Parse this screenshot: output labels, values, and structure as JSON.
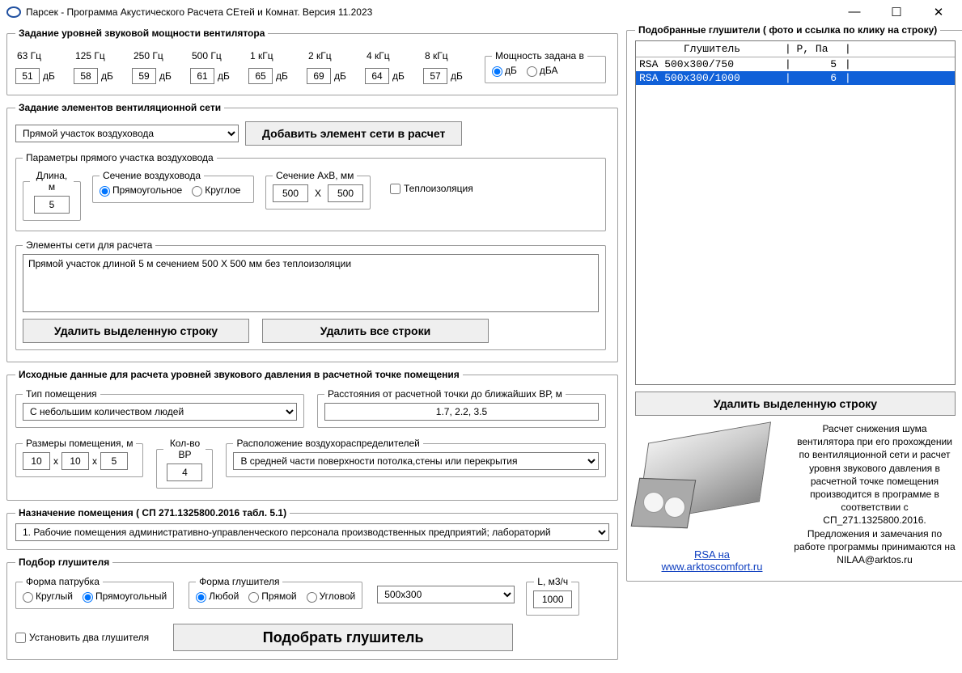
{
  "window": {
    "title": "Парсек - Программа Акустического Расчета СЕтей и Комнат.    Версия 11.2023"
  },
  "fan": {
    "legend": "Задание уровней звуковой мощности вентилятора",
    "freqs": [
      {
        "label": "63 Гц",
        "val": "51"
      },
      {
        "label": "125 Гц",
        "val": "58"
      },
      {
        "label": "250 Гц",
        "val": "59"
      },
      {
        "label": "500 Гц",
        "val": "61"
      },
      {
        "label": "1 кГц",
        "val": "65"
      },
      {
        "label": "2 кГц",
        "val": "69"
      },
      {
        "label": "4 кГц",
        "val": "64"
      },
      {
        "label": "8 кГц",
        "val": "57"
      }
    ],
    "db_suffix": "дБ",
    "power_legend": "Мощность задана в",
    "opt_db": "дБ",
    "opt_dba": "дБА"
  },
  "net": {
    "legend": "Задание элементов вентиляционной сети",
    "element_select": "Прямой участок воздуховода",
    "add_btn": "Добавить элемент сети в расчет",
    "params_legend": "Параметры прямого участка воздуховода",
    "len_legend": "Длина, м",
    "len": "5",
    "sect_legend": "Сечение воздуховода",
    "sect_rect": "Прямоугольное",
    "sect_round": "Круглое",
    "axb_legend": "Сечение АхВ, мм",
    "a": "500",
    "x": "X",
    "b": "500",
    "thermo": "Теплоизоляция",
    "elems_legend": "Элементы сети для расчета",
    "elem_line": "Прямой участок длиной 5 м сечением 500 Х 500 мм без теплоизоляции",
    "del_row": "Удалить выделенную строку",
    "del_all": "Удалить все строки"
  },
  "room": {
    "legend": "Исходные данные для расчета уровней звукового давления в расчетной точке помещения",
    "type_legend": "Тип помещения",
    "type_val": "С небольшим количеством людей",
    "dist_legend": "Расстояния от расчетной точки до ближайших ВР, м",
    "dist_val": "1.7, 2.2, 3.5",
    "dims_legend": "Размеры помещения, м",
    "d1": "10",
    "d2": "10",
    "d3": "5",
    "x": "x",
    "bp_legend": "Кол-во ВР",
    "bp": "4",
    "loc_legend": "Расположение воздухораспределителей",
    "loc_val": "В средней части поверхности потолка,стены или перекрытия"
  },
  "purpose": {
    "legend": "Назначение помещения  ( СП 271.1325800.2016 табл. 5.1)",
    "val": "1. Рабочие помещения административно-управленческого персонала производственных предприятий; лабораторий"
  },
  "sil": {
    "legend": "Подбор глушителя",
    "pat_legend": "Форма патрубка",
    "pat_round": "Круглый",
    "pat_rect": "Прямоугольный",
    "form_legend": "Форма глушителя",
    "f_any": "Любой",
    "f_straight": "Прямой",
    "f_angle": "Угловой",
    "size": "500x300",
    "l_legend": "L, м3/ч",
    "l": "1000",
    "two": "Установить два глушителя",
    "pick": "Подобрать глушитель"
  },
  "right": {
    "legend": "Подобранные глушители  ( фото и ссылка по клику на строку)",
    "hdr_name": "Глушитель",
    "hdr_p": "P, Па",
    "rows": [
      {
        "name": "RSA 500x300/750",
        "p": "5",
        "sel": false
      },
      {
        "name": "RSA 500x300/1000",
        "p": "6",
        "sel": true
      }
    ],
    "del": "Удалить выделенную строку",
    "link1": "RSA на",
    "link2": "www.arktoscomfort.ru",
    "info": "Расчет снижения шума вентилятора при  его прохождении по вентиляционной сети и расчет уровня звукового давления в расчетной точке помещения производится в программе в соответствии с СП_271.1325800.2016. Предложения и замечания по работе программы принимаются на NILAA@arktos.ru"
  }
}
